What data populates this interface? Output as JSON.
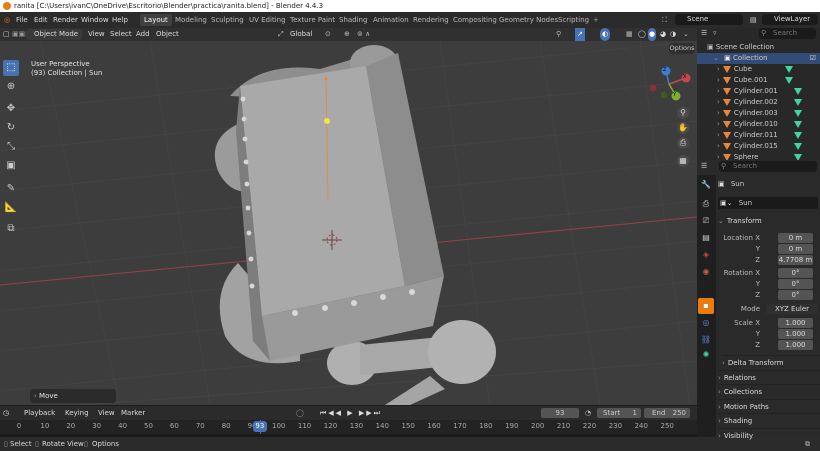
{
  "window": {
    "title": "ranita [C:\\Users\\ivanC\\OneDrive\\Escritorio\\Blender\\practica\\ranita.blend] - Blender 4.4.3"
  },
  "menus": [
    "File",
    "Edit",
    "Render",
    "Window",
    "Help"
  ],
  "workspaces": [
    "Layout",
    "Modeling",
    "Sculpting",
    "UV Editing",
    "Texture Paint",
    "Shading",
    "Animation",
    "Rendering",
    "Compositing",
    "Geometry Nodes",
    "Scripting"
  ],
  "add_tab": "+",
  "scene": "Scene",
  "view_layer": "ViewLayer",
  "viewport_header": {
    "mode": "Object Mode",
    "menus": [
      "View",
      "Select",
      "Add",
      "Object"
    ],
    "orientation": "Global",
    "options": "Options"
  },
  "viewport": {
    "perspective": "User Perspective",
    "collection_info": "(93) Collection | Sun",
    "last_op": "Move"
  },
  "gizmo": {
    "x": "X",
    "y": "Y",
    "z": "Z"
  },
  "timeline": {
    "menus": [
      "Playback",
      "Keying",
      "View",
      "Marker"
    ],
    "current_frame": "93",
    "start_label": "Start",
    "start": "1",
    "end_label": "End",
    "end": "250",
    "ticks": [
      "0",
      "10",
      "20",
      "30",
      "40",
      "50",
      "60",
      "70",
      "80",
      "90",
      "100",
      "110",
      "120",
      "130",
      "140",
      "150",
      "160",
      "170",
      "180",
      "190",
      "200",
      "210",
      "220",
      "230",
      "240",
      "250"
    ]
  },
  "statusbar": {
    "items": [
      "Select",
      "Rotate View",
      "Options"
    ]
  },
  "outliner": {
    "search_placeholder": "Search",
    "root": "Scene Collection",
    "collection": "Collection",
    "items": [
      "Cube",
      "Cube.001",
      "Cylinder.001",
      "Cylinder.002",
      "Cylinder.003",
      "Cylinder.010",
      "Cylinder.011",
      "Cylinder.015",
      "Sphere"
    ]
  },
  "properties": {
    "search_placeholder": "Search",
    "object_name": "Sun",
    "data_name": "Sun",
    "transform_label": "Transform",
    "location": {
      "label": "Location X",
      "x": "0 m",
      "y": "0 m",
      "z": "4.7708 m"
    },
    "rotation": {
      "label": "Rotation X",
      "x": "0°",
      "y": "0°",
      "z": "0°"
    },
    "mode_label": "Mode",
    "mode": "XYZ Euler",
    "scale": {
      "label": "Scale X",
      "x": "1.000",
      "y": "1.000",
      "z": "1.000"
    },
    "axis_y": "Y",
    "axis_z": "Z",
    "sections": [
      "Delta Transform",
      "Relations",
      "Collections",
      "Motion Paths",
      "Shading",
      "Visibility"
    ]
  },
  "colors": {
    "accent": "#4772b3",
    "x_axis": "#c8464f",
    "y_axis": "#7fae2f",
    "z_axis": "#3b7dd8",
    "selected_outline": "#e8873a"
  }
}
